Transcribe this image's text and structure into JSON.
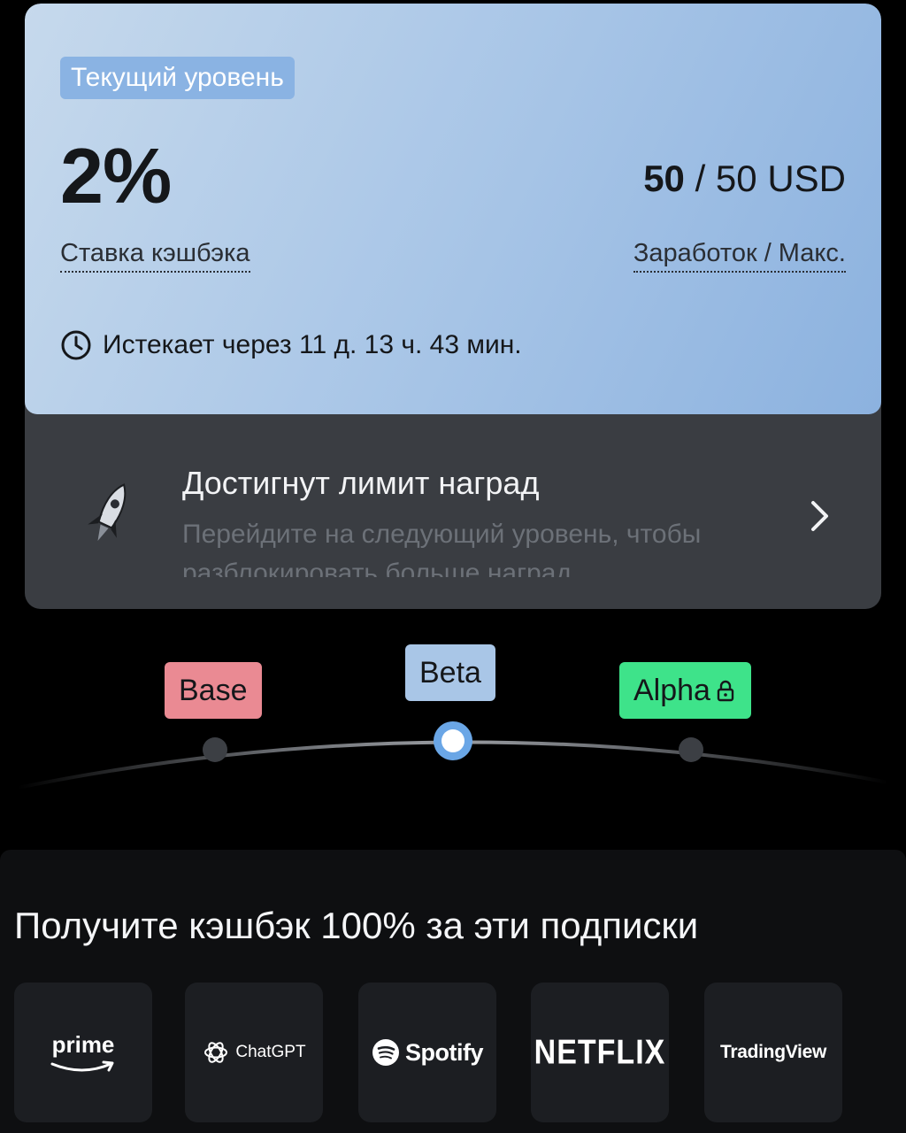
{
  "level": {
    "tag": "Текущий уровень",
    "rate": "2%",
    "rate_label": "Ставка кэшбэка",
    "earned": "50",
    "earned_max": "/ 50 USD",
    "earn_label": "Заработок / Макс.",
    "expires": "Истекает через 11 д. 13 ч. 43 мин."
  },
  "limit_notice": {
    "title": "Достигнут лимит наград",
    "description": "Перейдите на следующий уровень, чтобы разблокировать больше наград"
  },
  "tiers": [
    {
      "name": "Base",
      "color": "#ea8a93",
      "state": "past"
    },
    {
      "name": "Beta",
      "color": "#a9c6e7",
      "state": "current"
    },
    {
      "name": "Alpha",
      "color": "#3ee38a",
      "state": "locked"
    }
  ],
  "subscriptions": {
    "title": "Получите кэшбэк 100% за эти подписки",
    "items": [
      {
        "name": "prime"
      },
      {
        "name": "ChatGPT"
      },
      {
        "name": "Spotify"
      },
      {
        "name": "NETFLIX"
      },
      {
        "name": "TradingView"
      }
    ]
  }
}
